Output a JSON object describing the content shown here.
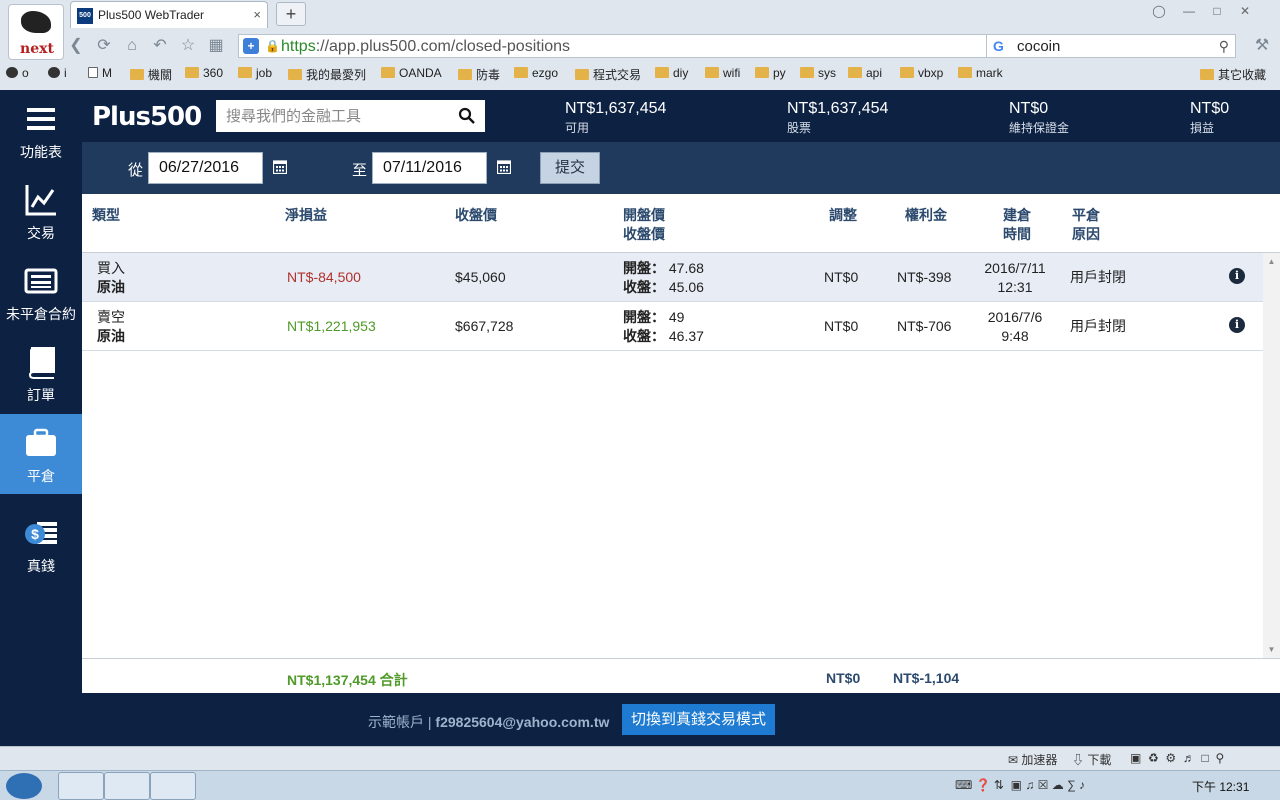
{
  "browser": {
    "tab_title": "Plus500 WebTrader",
    "favicon_text": "500",
    "tab_close": "×",
    "new_tab": "+",
    "url_scheme": "https",
    "url_rest": "://app.plus500.com/closed-positions",
    "search_engine": "G",
    "search_query": "cocoin",
    "logo_text": "next",
    "bookmarks": [
      {
        "label": "o"
      },
      {
        "label": "i"
      },
      {
        "label": "M"
      },
      {
        "label": "機關"
      },
      {
        "label": "360"
      },
      {
        "label": "job"
      },
      {
        "label": "我的最愛列"
      },
      {
        "label": "OANDA"
      },
      {
        "label": "防毒"
      },
      {
        "label": "ezgo"
      },
      {
        "label": "程式交易"
      },
      {
        "label": "diy"
      },
      {
        "label": "wifi"
      },
      {
        "label": "py"
      },
      {
        "label": "sys"
      },
      {
        "label": "api"
      },
      {
        "label": "vbxp"
      },
      {
        "label": "mark"
      }
    ],
    "other_bookmarks": "其它收藏"
  },
  "app": {
    "brand": "Plus500",
    "search_placeholder": "搜尋我們的金融工具",
    "stats": [
      {
        "value": "NT$1,637,454",
        "label": "可用"
      },
      {
        "value": "NT$1,637,454",
        "label": "股票"
      },
      {
        "value": "NT$0",
        "label": "維持保證金"
      },
      {
        "value": "NT$0",
        "label": "損益"
      }
    ],
    "sidebar": [
      {
        "label": "功能表",
        "icon": "menu-icon"
      },
      {
        "label": "交易",
        "icon": "chart-icon"
      },
      {
        "label": "未平倉合約",
        "icon": "open-positions-icon"
      },
      {
        "label": "訂單",
        "icon": "book-icon"
      },
      {
        "label": "平倉",
        "icon": "briefcase-icon"
      },
      {
        "label": "真錢",
        "icon": "money-icon"
      }
    ],
    "filter": {
      "from_label": "從",
      "from_date": "06/27/2016",
      "to_label": "至",
      "to_date": "07/11/2016",
      "submit": "提交"
    },
    "columns": {
      "type": "類型",
      "net_pl": "淨損益",
      "close_price": "收盤價",
      "open_price": "開盤價",
      "close_price2": "收盤價",
      "adjust": "調整",
      "premium": "權利金",
      "open_time_1": "建倉",
      "open_time_2": "時間",
      "close_reason_1": "平倉",
      "close_reason_2": "原因"
    },
    "rows": [
      {
        "side": "買入",
        "instrument": "原油",
        "net_pl": "NT$-84,500",
        "close_price": "$45,060",
        "open_label": "開盤：",
        "open_value": "47.68",
        "close_label": "收盤：",
        "close_value": "45.06",
        "adjust": "NT$0",
        "premium": "NT$-398",
        "date": "2016/7/11",
        "time": "12:31",
        "reason": "用戶封閉"
      },
      {
        "side": "賣空",
        "instrument": "原油",
        "net_pl": "NT$1,221,953",
        "close_price": "$667,728",
        "open_label": "開盤：",
        "open_value": "49",
        "close_label": "收盤：",
        "close_value": "46.37",
        "adjust": "NT$0",
        "premium": "NT$-706",
        "date": "2016/7/6",
        "time": "9:48",
        "reason": "用戶封閉"
      }
    ],
    "totals": {
      "net_pl": "NT$1,137,454",
      "label": "合計",
      "adjust": "NT$0",
      "premium": "NT$-1,104"
    },
    "footer": {
      "account_label": "示範帳戶 |",
      "email": "f29825604@yahoo.com.tw",
      "switch_button": "切換到真錢交易模式"
    }
  },
  "statusbar": {
    "accelerator": "加速器",
    "download": "下載"
  },
  "taskbar": {
    "clock": "下午 12:31"
  },
  "colors": {
    "navy": "#0d2143",
    "filter_bar": "#1f3a5c",
    "active_blue": "#3d8ad6",
    "loss_red": "#b1312b",
    "gain_green": "#4f9a29"
  }
}
